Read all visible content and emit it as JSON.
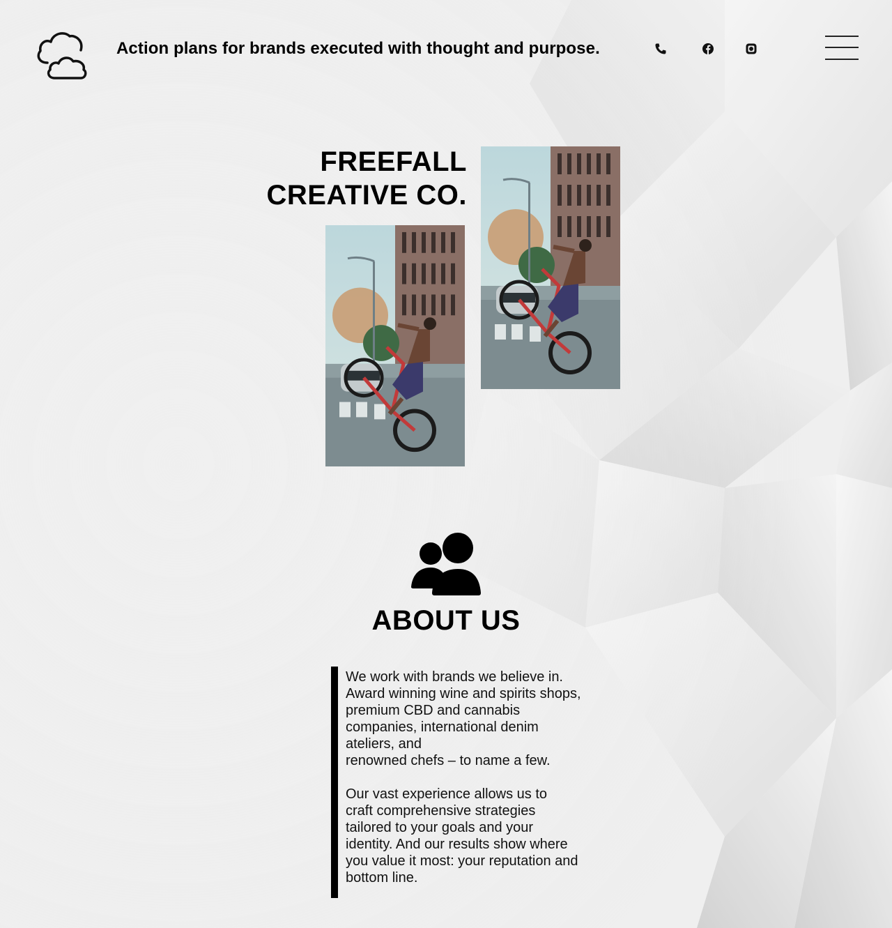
{
  "header": {
    "tagline": "Action plans for brands executed with thought and purpose.",
    "logo_icon": "cloud-logo-icon",
    "social": [
      {
        "name": "phone",
        "icon": "phone-icon"
      },
      {
        "name": "facebook",
        "icon": "facebook-icon"
      },
      {
        "name": "instagram",
        "icon": "instagram-icon"
      }
    ],
    "menu_icon": "hamburger-menu-icon"
  },
  "hero": {
    "title_line1": "FREEFALL",
    "title_line2": "CREATIVE CO.",
    "photos": [
      {
        "subject": "cyclist-wheelie-street-photo"
      },
      {
        "subject": "cyclist-wheelie-street-photo"
      }
    ]
  },
  "about": {
    "icon": "people-group-icon",
    "title": "ABOUT US",
    "paragraph1_lines": [
      "We work with brands we believe in.",
      "Award winning wine and spirits shops,",
      "premium CBD and cannabis",
      "companies, international denim",
      "ateliers, and",
      "renowned chefs – to name a few."
    ],
    "paragraph2_lines": [
      "Our vast experience allows us to",
      "craft comprehensive strategies",
      "tailored to your goals and your",
      "identity. And our results show where",
      "you value it most: your reputation and",
      "bottom line."
    ]
  },
  "colors": {
    "background": "#efefef",
    "text": "#000000",
    "accent_bar": "#000000"
  }
}
